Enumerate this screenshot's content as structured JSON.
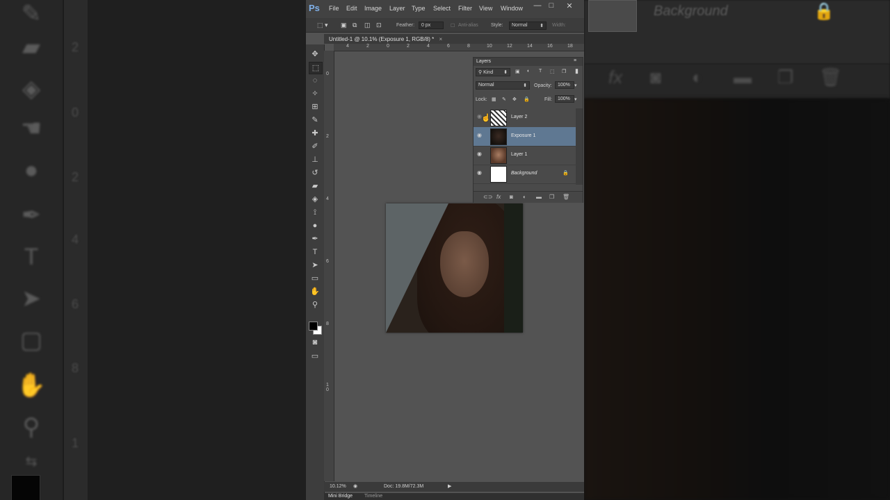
{
  "app": {
    "logo": "Ps"
  },
  "menu": [
    "File",
    "Edit",
    "Image",
    "Layer",
    "Type",
    "Select",
    "Filter",
    "View",
    "Window"
  ],
  "window_controls": {
    "minimize": "—",
    "maximize": "□",
    "close": "✕"
  },
  "options_bar": {
    "feather_label": "Feather:",
    "feather_value": "0 px",
    "antialias_label": "Anti-alias",
    "style_label": "Style:",
    "style_value": "Normal",
    "width_label": "Width:"
  },
  "document_tab": {
    "title": "Untitled-1 @ 10.1% (Exposure 1, RGB/8) *",
    "close": "×"
  },
  "ruler": {
    "top": [
      "4",
      "2",
      "0",
      "2",
      "4",
      "6",
      "8",
      "10",
      "12",
      "14",
      "16",
      "18"
    ],
    "left": [
      "0",
      "2",
      "4",
      "6",
      "8",
      "1\n0"
    ]
  },
  "layers_panel": {
    "title": "Layers",
    "filter_value": "Kind",
    "blend_mode": "Normal",
    "opacity_label": "Opacity:",
    "opacity_value": "100%",
    "lock_label": "Lock:",
    "fill_label": "Fill:",
    "fill_value": "100%",
    "layers": [
      {
        "name": "Layer 2",
        "selected": false
      },
      {
        "name": "Exposure 1",
        "selected": true
      },
      {
        "name": "Layer 1",
        "selected": false
      },
      {
        "name": "Background",
        "selected": false,
        "locked": true
      }
    ]
  },
  "status_bar": {
    "zoom": "10.12%",
    "doc_info": "Doc: 19.8M/72.3M"
  },
  "bottom_tabs": [
    "Mini Bridge",
    "Timeline"
  ],
  "background_right": {
    "layer_label": "Background"
  },
  "background_left": {
    "ruler_numbers": [
      "2",
      "0",
      "2",
      "4",
      "6",
      "8",
      "1"
    ]
  },
  "colors": {
    "accent": "#5f7892",
    "panel": "#4a4a4a",
    "workspace": "#535353"
  }
}
